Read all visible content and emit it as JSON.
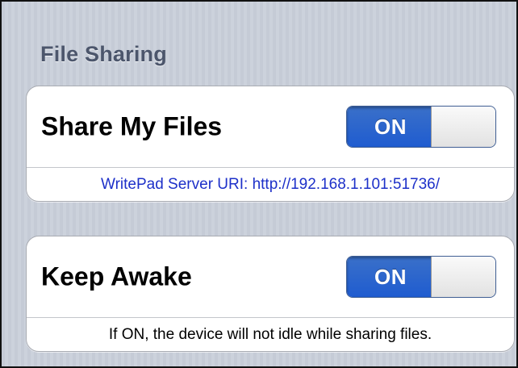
{
  "section": {
    "header": "File Sharing"
  },
  "share_files": {
    "label": "Share My Files",
    "toggle_state": "ON",
    "server_uri": "WritePad Server URI: http://192.168.1.101:51736/"
  },
  "keep_awake": {
    "label": "Keep Awake",
    "toggle_state": "ON",
    "note": "If ON, the device will not idle while sharing files."
  },
  "colors": {
    "toggle_on": "#2a66cf",
    "uri_link": "#1d30c9",
    "section_header": "#4c566c",
    "background": "#c6ccd7"
  }
}
